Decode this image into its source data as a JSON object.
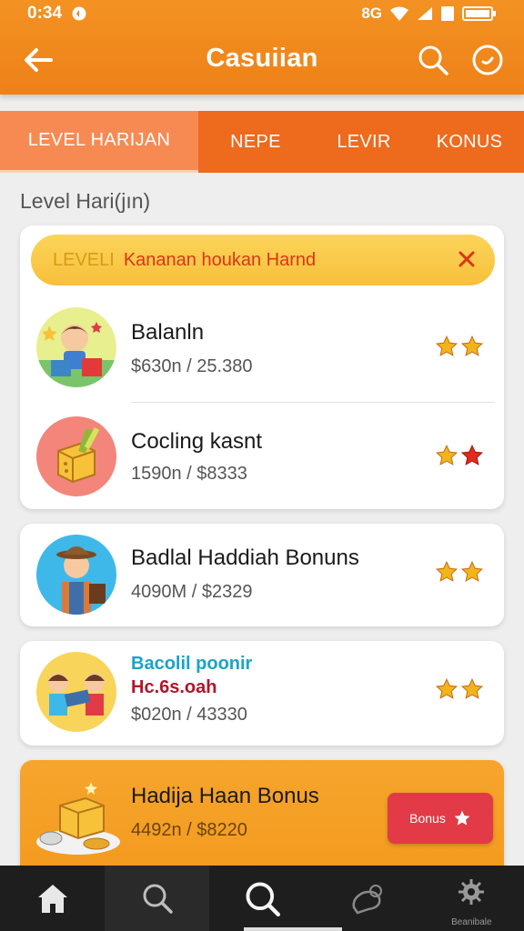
{
  "status_bar": {
    "time": "0:34",
    "right_text": "8G"
  },
  "app_bar": {
    "title": "Casuiian"
  },
  "tabs": [
    {
      "label": "LEVEL HARIJAN",
      "active": true
    },
    {
      "label": "NEPE",
      "active": false
    },
    {
      "label": "LEVIR",
      "active": false
    },
    {
      "label": "KONUS",
      "active": false
    }
  ],
  "section_title": "Level Hari(jın)",
  "banner": {
    "level": "LEVELI",
    "message": "Kananan houkan Harnd"
  },
  "items": [
    {
      "name": "Balanln",
      "value": "$630n / 25.380",
      "stars": 2,
      "icon": "shopping-boy-avatar"
    },
    {
      "name": "Cocling kasnt",
      "value": "1590n / $8333",
      "stars": 2,
      "icon": "gold-box-icon"
    },
    {
      "name": "Badlal Haddiah Bonuns",
      "value": "4090M / $2329",
      "stars": 2,
      "icon": "explorer-avatar"
    },
    {
      "name_line1": "Bacolil poonir",
      "name_line2": "Hc.6s.oah",
      "value": "$020n / 43330",
      "stars": 2,
      "icon": "trading-kids-avatar"
    }
  ],
  "bonus_card": {
    "name": "Hadija Haan Bonus",
    "value": "4492n / $8220",
    "button_label": "Bonus",
    "icon": "treasure-box-icon"
  },
  "bottom_nav": [
    {
      "icon": "home-icon",
      "label": ""
    },
    {
      "icon": "search-icon",
      "label": ""
    },
    {
      "icon": "search-icon",
      "label": ""
    },
    {
      "icon": "chat-icon",
      "label": ""
    },
    {
      "icon": "settings-icon",
      "label": "Beanibale"
    }
  ],
  "colors": {
    "primary": "#ee8118",
    "tab_bar": "#ee6a1c",
    "banner": "#f7c03a",
    "star": "#f2b519",
    "star_red": "#e02a1b",
    "button": "#e23a47"
  }
}
